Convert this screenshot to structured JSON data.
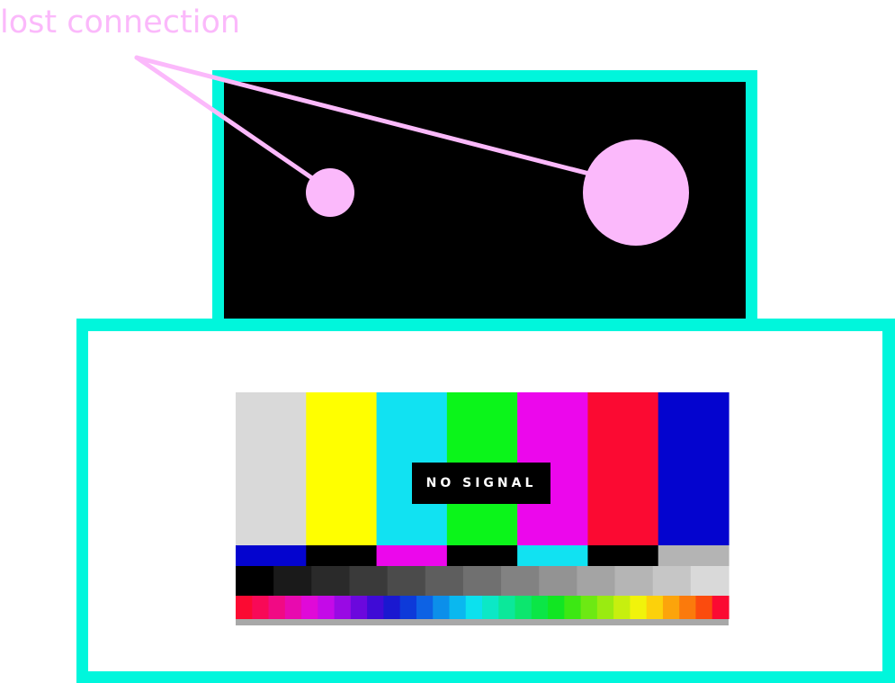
{
  "annotation": {
    "text": "lost connection",
    "color": "#fbb9fb"
  },
  "colors": {
    "frame": "#00f6dc",
    "screen_background": "#000000",
    "panel_background": "#ffffff",
    "spot": "#fbb9fb"
  },
  "test_pattern": {
    "message": "NO SIGNAL",
    "main_bars": [
      "#d9d9d9",
      "#ffff00",
      "#11e2f2",
      "#0bf51a",
      "#ec07ec",
      "#fb0a32",
      "#0404cf"
    ],
    "castellation_row": [
      "#0404cf",
      "#000000",
      "#ec07ec",
      "#000000",
      "#11e2f2",
      "#000000",
      "#b4b4b4"
    ],
    "grayscale_row": [
      "#000000",
      "#1a1a1a",
      "#2a2a2a",
      "#3a3a3a",
      "#4b4b4b",
      "#5e5e5e",
      "#707070",
      "#828282",
      "#939393",
      "#a4a4a4",
      "#b5b5b5",
      "#c6c6c6",
      "#d9d9d9"
    ],
    "spectrum_row": [
      "#fb0a32",
      "#f80957",
      "#f10a84",
      "#e80aaf",
      "#e009d8",
      "#c40ae8",
      "#990ae4",
      "#6b08dd",
      "#3f0bd6",
      "#1a18d0",
      "#0d3ad9",
      "#0d62e4",
      "#0c8fea",
      "#0ab8ef",
      "#0ce1ee",
      "#0ce8c6",
      "#0be89a",
      "#0ce66e",
      "#0be646",
      "#11e622",
      "#3ce813",
      "#6de913",
      "#9aeb11",
      "#c7ef0f",
      "#f1f30b",
      "#fcd10b",
      "#fca40b",
      "#fb7a0c",
      "#fb4b0e",
      "#fb0a32"
    ]
  }
}
